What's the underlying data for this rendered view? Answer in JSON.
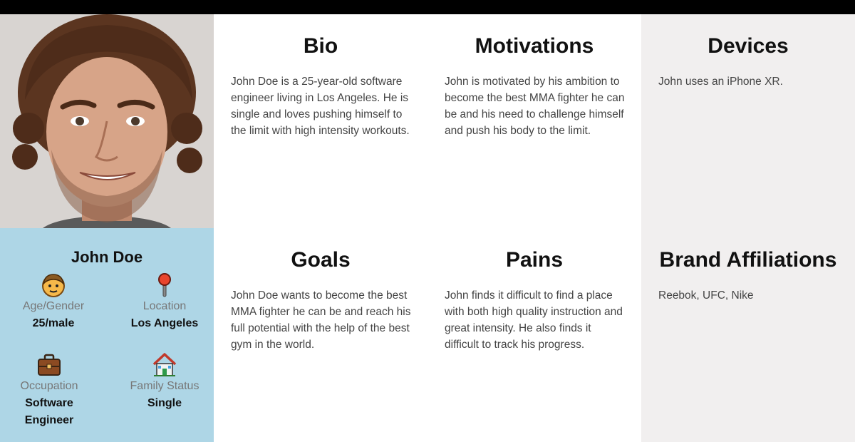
{
  "persona": {
    "name": "John Doe",
    "attributes": [
      {
        "icon": "person-face-icon",
        "label": "Age/Gender",
        "value": "25/male"
      },
      {
        "icon": "location-pin-icon",
        "label": "Location",
        "value": "Los Angeles"
      },
      {
        "icon": "briefcase-icon",
        "label": "Occupation",
        "value": "Software Engineer"
      },
      {
        "icon": "house-icon",
        "label": "Family Status",
        "value": "Single"
      }
    ]
  },
  "sections": {
    "bio": {
      "title": "Bio",
      "text": "John Doe is a 25-year-old software engineer living in Los Angeles. He is single and loves pushing himself to the limit with high intensity workouts."
    },
    "motivations": {
      "title": "Motivations",
      "text": "John is motivated by his ambition to become the best MMA fighter he can be and his need to challenge himself and push his body to the limit."
    },
    "devices": {
      "title": "Devices",
      "text": "John uses an iPhone XR."
    },
    "goals": {
      "title": "Goals",
      "text": "John Doe wants to become the best MMA fighter he can be and reach his full potential with the help of the best gym in the world."
    },
    "pains": {
      "title": "Pains",
      "text": "John finds it difficult to find a place with both high quality instruction and great intensity. He also finds it difficult to track his progress."
    },
    "brand_affiliations": {
      "title": "Brand Affiliations",
      "text": "Reebok, UFC, Nike"
    }
  },
  "colors": {
    "profile_bg": "#aed6e6",
    "grey_column_bg": "#f1efef",
    "top_bar": "#000000"
  }
}
